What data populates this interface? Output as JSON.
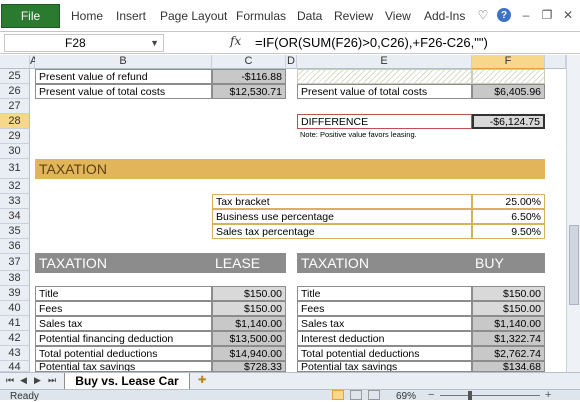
{
  "ribbon": {
    "file": "File",
    "tabs": [
      "Home",
      "Insert",
      "Page Layout",
      "Formulas",
      "Data",
      "Review",
      "View",
      "Add-Ins"
    ]
  },
  "formula_bar": {
    "cell_ref": "F28",
    "fx": "fx",
    "formula": "=IF(OR(SUM(F26)>0,C26),+F26-C26,\"\")"
  },
  "columns": [
    "A",
    "B",
    "C",
    "D",
    "E",
    "F"
  ],
  "selected_column": "F",
  "rows": [
    "25",
    "26",
    "27",
    "28",
    "29",
    "30",
    "31",
    "32",
    "33",
    "34",
    "35",
    "36",
    "37",
    "38",
    "39",
    "40",
    "41",
    "42",
    "43",
    "44"
  ],
  "selected_row": "28",
  "lease_top": {
    "pv_refund_label": "Present value of refund",
    "pv_refund_value": "-$116.88",
    "pv_total_label": "Present value of total costs",
    "pv_total_value": "$12,530.71"
  },
  "buy_top": {
    "pv_total_label": "Present value of total costs",
    "pv_total_value": "$6,405.96"
  },
  "difference": {
    "label": "DIFFERENCE",
    "value": "-$6,124.75",
    "note": "Note: Positive value favors leasing."
  },
  "taxation_section": {
    "title": "TAXATION",
    "rows": [
      {
        "label": "Tax bracket",
        "value": "25.00%"
      },
      {
        "label": "Business use percentage",
        "value": "6.50%"
      },
      {
        "label": "Sales tax percentage",
        "value": "9.50%"
      }
    ]
  },
  "lease_table": {
    "title": "TAXATION",
    "subtitle": "LEASE",
    "rows": [
      {
        "label": "Title",
        "value": "$150.00"
      },
      {
        "label": "Fees",
        "value": "$150.00"
      },
      {
        "label": "Sales tax",
        "value": "$1,140.00"
      },
      {
        "label": "Potential financing deduction",
        "value": "$13,500.00"
      },
      {
        "label": "Total potential deductions",
        "value": "$14,940.00"
      },
      {
        "label": "Potential tax savings",
        "value": "$728.33"
      }
    ]
  },
  "buy_table": {
    "title": "TAXATION",
    "subtitle": "BUY",
    "rows": [
      {
        "label": "Title",
        "value": "$150.00"
      },
      {
        "label": "Fees",
        "value": "$150.00"
      },
      {
        "label": "Sales tax",
        "value": "$1,140.00"
      },
      {
        "label": "Interest deduction",
        "value": "$1,322.74"
      },
      {
        "label": "Total potential deductions",
        "value": "$2,762.74"
      },
      {
        "label": "Potential tax savings",
        "value": "$134.68"
      }
    ]
  },
  "sheet_tab": "Buy vs. Lease Car",
  "status": {
    "ready": "Ready",
    "zoom": "69%"
  }
}
